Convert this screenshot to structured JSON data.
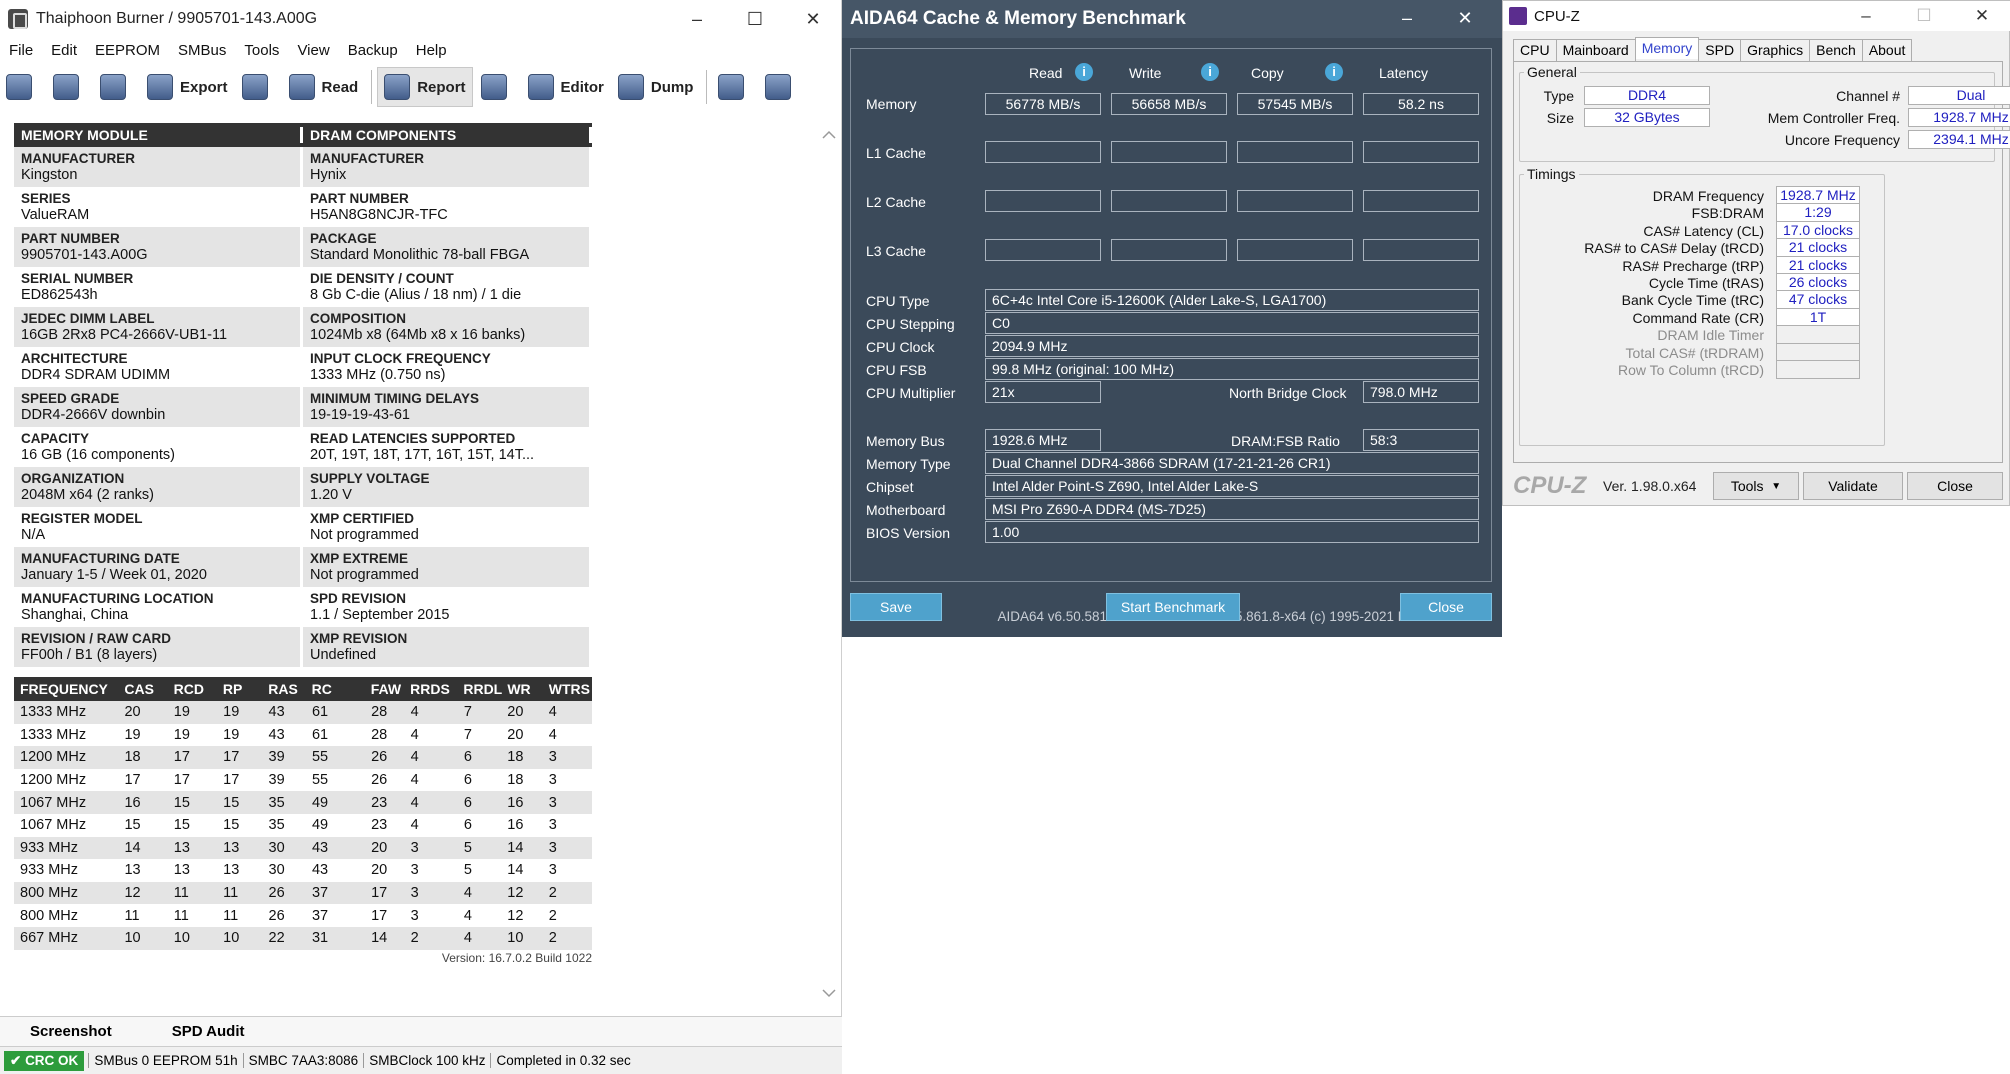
{
  "thaiphoon": {
    "title": "Thaiphoon Burner / 9905701-143.A00G",
    "menu": [
      "File",
      "Edit",
      "EEPROM",
      "SMBus",
      "Tools",
      "View",
      "Backup",
      "Help"
    ],
    "toolbar": {
      "export": "Export",
      "read": "Read",
      "report": "Report",
      "editor": "Editor",
      "dump": "Dump"
    },
    "headers": {
      "left": "MEMORY MODULE",
      "right": "DRAM COMPONENTS"
    },
    "rows": [
      {
        "lk": "MANUFACTURER",
        "lv": "Kingston",
        "rk": "MANUFACTURER",
        "rv": "Hynix"
      },
      {
        "lk": "SERIES",
        "lv": "ValueRAM",
        "rk": "PART NUMBER",
        "rv": "H5AN8G8NCJR-TFC"
      },
      {
        "lk": "PART NUMBER",
        "lv": "9905701-143.A00G",
        "rk": "PACKAGE",
        "rv": "Standard Monolithic 78-ball FBGA"
      },
      {
        "lk": "SERIAL NUMBER",
        "lv": "ED862543h",
        "rk": "DIE DENSITY / COUNT",
        "rv": "8 Gb C-die (Alius / 18 nm) / 1 die"
      },
      {
        "lk": "JEDEC DIMM LABEL",
        "lv": "16GB 2Rx8 PC4-2666V-UB1-11",
        "rk": "COMPOSITION",
        "rv": "1024Mb x8 (64Mb x8 x 16 banks)"
      },
      {
        "lk": "ARCHITECTURE",
        "lv": "DDR4 SDRAM UDIMM",
        "rk": "INPUT CLOCK FREQUENCY",
        "rv": "1333 MHz (0.750 ns)"
      },
      {
        "lk": "SPEED GRADE",
        "lv": "DDR4-2666V downbin",
        "rk": "MINIMUM TIMING DELAYS",
        "rv": "19-19-19-43-61"
      },
      {
        "lk": "CAPACITY",
        "lv": "16 GB (16 components)",
        "rk": "READ LATENCIES SUPPORTED",
        "rv": "20T, 19T, 18T, 17T, 16T, 15T, 14T..."
      },
      {
        "lk": "ORGANIZATION",
        "lv": "2048M x64 (2 ranks)",
        "rk": "SUPPLY VOLTAGE",
        "rv": "1.20 V"
      },
      {
        "lk": "REGISTER MODEL",
        "lv": "N/A",
        "rk": "XMP CERTIFIED",
        "rv": "Not programmed"
      },
      {
        "lk": "MANUFACTURING DATE",
        "lv": "January 1-5 / Week 01, 2020",
        "rk": "XMP EXTREME",
        "rv": "Not programmed"
      },
      {
        "lk": "MANUFACTURING LOCATION",
        "lv": "Shanghai, China",
        "rk": "SPD REVISION",
        "rv": "1.1 / September 2015"
      },
      {
        "lk": "REVISION / RAW CARD",
        "lv": "FF00h / B1 (8 layers)",
        "rk": "XMP REVISION",
        "rv": "Undefined"
      }
    ],
    "timing_headers": [
      "FREQUENCY",
      "CAS",
      "RCD",
      "RP",
      "RAS",
      "RC",
      "FAW",
      "RRDS",
      "RRDL",
      "WR",
      "WTRS"
    ],
    "timing_rows": [
      [
        "1333 MHz",
        "20",
        "19",
        "19",
        "43",
        "61",
        "28",
        "4",
        "7",
        "20",
        "4"
      ],
      [
        "1333 MHz",
        "19",
        "19",
        "19",
        "43",
        "61",
        "28",
        "4",
        "7",
        "20",
        "4"
      ],
      [
        "1200 MHz",
        "18",
        "17",
        "17",
        "39",
        "55",
        "26",
        "4",
        "6",
        "18",
        "3"
      ],
      [
        "1200 MHz",
        "17",
        "17",
        "17",
        "39",
        "55",
        "26",
        "4",
        "6",
        "18",
        "3"
      ],
      [
        "1067 MHz",
        "16",
        "15",
        "15",
        "35",
        "49",
        "23",
        "4",
        "6",
        "16",
        "3"
      ],
      [
        "1067 MHz",
        "15",
        "15",
        "15",
        "35",
        "49",
        "23",
        "4",
        "6",
        "16",
        "3"
      ],
      [
        "933 MHz",
        "14",
        "13",
        "13",
        "30",
        "43",
        "20",
        "3",
        "5",
        "14",
        "3"
      ],
      [
        "933 MHz",
        "13",
        "13",
        "13",
        "30",
        "43",
        "20",
        "3",
        "5",
        "14",
        "3"
      ],
      [
        "800 MHz",
        "12",
        "11",
        "11",
        "26",
        "37",
        "17",
        "3",
        "4",
        "12",
        "2"
      ],
      [
        "800 MHz",
        "11",
        "11",
        "11",
        "26",
        "37",
        "17",
        "3",
        "4",
        "12",
        "2"
      ],
      [
        "667 MHz",
        "10",
        "10",
        "10",
        "22",
        "31",
        "14",
        "2",
        "4",
        "10",
        "2"
      ]
    ],
    "version": "Version: 16.7.0.2 Build 1022",
    "tabs": [
      "Screenshot",
      "SPD Audit"
    ],
    "status": {
      "crc": "CRC OK",
      "smbus": "SMBus 0 EEPROM 51h",
      "smbc": "SMBC 7AA3:8086",
      "clock": "SMBClock 100 kHz",
      "done": "Completed in 0.32 sec"
    }
  },
  "aida": {
    "title": "AIDA64 Cache & Memory Benchmark",
    "cols": [
      "Read",
      "Write",
      "Copy",
      "Latency"
    ],
    "rows": {
      "memory": "Memory",
      "l1": "L1 Cache",
      "l2": "L2 Cache",
      "l3": "L3 Cache"
    },
    "memory_vals": [
      "56778 MB/s",
      "56658 MB/s",
      "57545 MB/s",
      "58.2 ns"
    ],
    "cpu_type_label": "CPU Type",
    "cpu_type": "6C+4c Intel Core i5-12600K  (Alder Lake-S, LGA1700)",
    "cpu_step_label": "CPU Stepping",
    "cpu_step": "C0",
    "cpu_clock_label": "CPU Clock",
    "cpu_clock": "2094.9 MHz",
    "cpu_fsb_label": "CPU FSB",
    "cpu_fsb": "99.8 MHz  (original: 100 MHz)",
    "cpu_mult_label": "CPU Multiplier",
    "cpu_mult": "21x",
    "nb_label": "North Bridge Clock",
    "nb": "798.0 MHz",
    "mem_bus_label": "Memory Bus",
    "mem_bus": "1928.6 MHz",
    "ratio_label": "DRAM:FSB Ratio",
    "ratio": "58:3",
    "mem_type_label": "Memory Type",
    "mem_type": "Dual Channel DDR4-3866 SDRAM  (17-21-21-26 CR1)",
    "chipset_label": "Chipset",
    "chipset": "Intel Alder Point-S Z690, Intel Alder Lake-S",
    "mobo_label": "Motherboard",
    "mobo": "MSI Pro Z690-A DDR4 (MS-7D25)",
    "bios_label": "BIOS Version",
    "bios": "1.00",
    "footer": "AIDA64 v6.50.5814 Beta / BenchDLL 4.5.861.8-x64  (c) 1995-2021 FinalWire Ltd.",
    "buttons": {
      "save": "Save",
      "start": "Start Benchmark",
      "close": "Close"
    }
  },
  "cpuz": {
    "title": "CPU-Z",
    "tabs": [
      "CPU",
      "Mainboard",
      "Memory",
      "SPD",
      "Graphics",
      "Bench",
      "About"
    ],
    "general_label": "General",
    "type_label": "Type",
    "type": "DDR4",
    "size_label": "Size",
    "size": "32 GBytes",
    "channel_label": "Channel #",
    "channel": "Dual",
    "mcf_label": "Mem Controller Freq.",
    "mcf": "1928.7 MHz",
    "uncore_label": "Uncore Frequency",
    "uncore": "2394.1 MHz",
    "timings_label": "Timings",
    "timings": [
      {
        "l": "DRAM Frequency",
        "v": "1928.7 MHz"
      },
      {
        "l": "FSB:DRAM",
        "v": "1:29"
      },
      {
        "l": "CAS# Latency (CL)",
        "v": "17.0 clocks"
      },
      {
        "l": "RAS# to CAS# Delay (tRCD)",
        "v": "21 clocks"
      },
      {
        "l": "RAS# Precharge (tRP)",
        "v": "21 clocks"
      },
      {
        "l": "Cycle Time (tRAS)",
        "v": "26 clocks"
      },
      {
        "l": "Bank Cycle Time (tRC)",
        "v": "47 clocks"
      },
      {
        "l": "Command Rate (CR)",
        "v": "1T"
      },
      {
        "l": "DRAM Idle Timer",
        "v": ""
      },
      {
        "l": "Total CAS# (tRDRAM)",
        "v": ""
      },
      {
        "l": "Row To Column (tRCD)",
        "v": ""
      }
    ],
    "logo": "CPU-Z",
    "version": "Ver. 1.98.0.x64",
    "buttons": {
      "tools": "Tools",
      "validate": "Validate",
      "close": "Close"
    }
  }
}
